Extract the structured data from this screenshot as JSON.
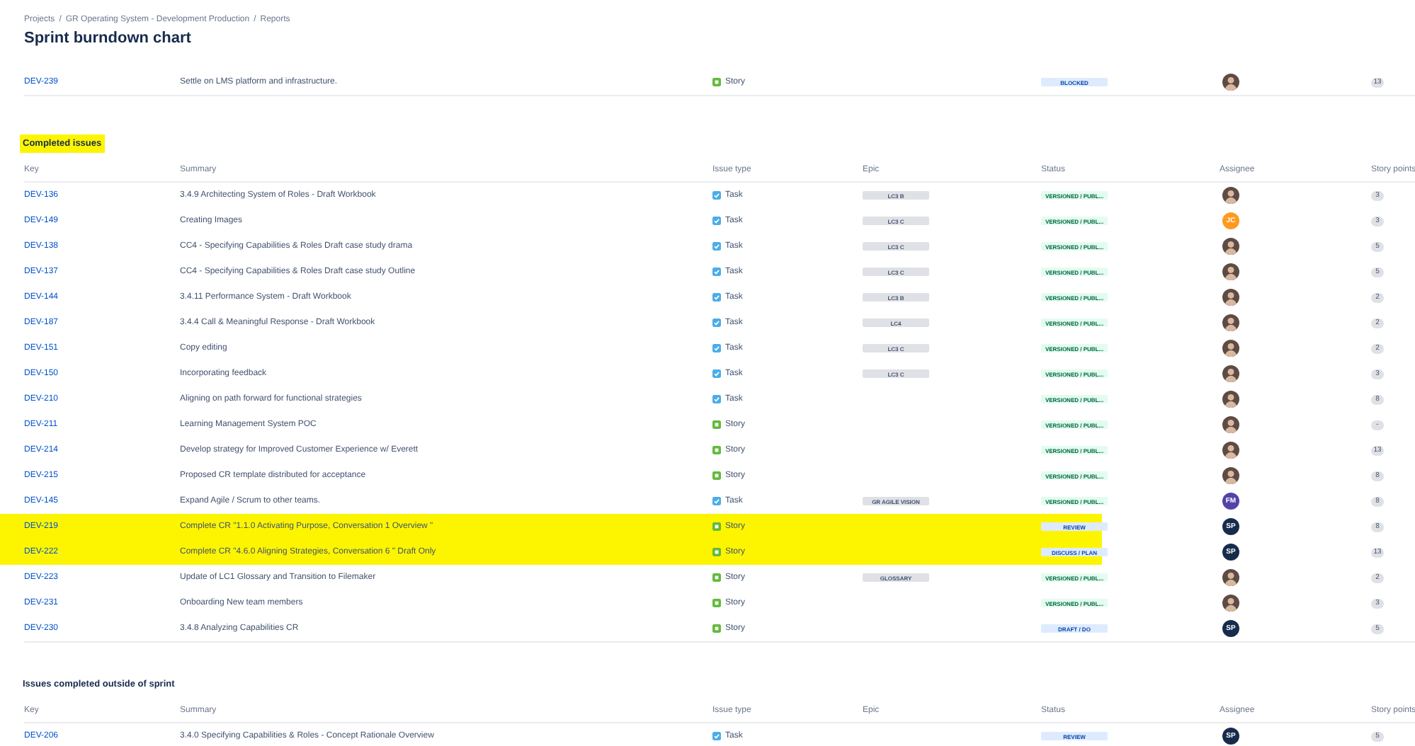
{
  "breadcrumbs": [
    "Projects",
    "GR Operating System - Development Production",
    "Reports"
  ],
  "breadcrumb_separator": "/",
  "title": "Sprint burndown chart",
  "top_rows": [
    {
      "key": "DEV-239",
      "summary": "Settle on LMS platform and infrastructure.",
      "kind": "story",
      "issue_type": "Story",
      "status": {
        "text": "BLOCKED",
        "color": "#0747a6"
      },
      "assignee": {
        "kind": "photo"
      },
      "points": "13",
      "highlighted": false
    }
  ],
  "sections": [
    {
      "title": "Completed issues",
      "highlighted": true,
      "columns": [
        "Key",
        "Summary",
        "Issue type",
        "Epic",
        "Status",
        "Assignee",
        "Story points"
      ],
      "rows": [
        {
          "key": "DEV-136",
          "summary": "3.4.9 Architecting System of Roles - Draft Workbook",
          "kind": "task",
          "issue_type": "Task",
          "epic": "LC3 B",
          "status": {
            "text": "VERSIONED / PUBL...",
            "color": "#006644"
          },
          "assignee": {
            "kind": "photo"
          },
          "points": "3",
          "highlighted": false
        },
        {
          "key": "DEV-149",
          "summary": "Creating Images",
          "kind": "task",
          "issue_type": "Task",
          "epic": "LC3 C",
          "status": {
            "text": "VERSIONED / PUBL...",
            "color": "#006644"
          },
          "assignee": {
            "kind": "initials",
            "initials": "JC",
            "color": "#ff991f"
          },
          "points": "3",
          "highlighted": false
        },
        {
          "key": "DEV-138",
          "summary": "CC4 - Specifying Capabilities & Roles Draft case study drama",
          "kind": "task",
          "issue_type": "Task",
          "epic": "LC3 C",
          "status": {
            "text": "VERSIONED / PUBL...",
            "color": "#006644"
          },
          "assignee": {
            "kind": "photo"
          },
          "points": "5",
          "highlighted": false
        },
        {
          "key": "DEV-137",
          "summary": "CC4 - Specifying Capabilities & Roles Draft case study Outline",
          "kind": "task",
          "issue_type": "Task",
          "epic": "LC3 C",
          "status": {
            "text": "VERSIONED / PUBL...",
            "color": "#006644"
          },
          "assignee": {
            "kind": "photo"
          },
          "points": "5",
          "highlighted": false
        },
        {
          "key": "DEV-144",
          "summary": "3.4.11 Performance System - Draft Workbook",
          "kind": "task",
          "issue_type": "Task",
          "epic": "LC3 B",
          "status": {
            "text": "VERSIONED / PUBL...",
            "color": "#006644"
          },
          "assignee": {
            "kind": "photo"
          },
          "points": "2",
          "highlighted": false
        },
        {
          "key": "DEV-187",
          "summary": "3.4.4 Call & Meaningful Response - Draft Workbook",
          "kind": "task",
          "issue_type": "Task",
          "epic": "LC4",
          "status": {
            "text": "VERSIONED / PUBL...",
            "color": "#006644"
          },
          "assignee": {
            "kind": "photo"
          },
          "points": "2",
          "highlighted": false
        },
        {
          "key": "DEV-151",
          "summary": "Copy editing",
          "kind": "task",
          "issue_type": "Task",
          "epic": "LC3 C",
          "status": {
            "text": "VERSIONED / PUBL...",
            "color": "#006644"
          },
          "assignee": {
            "kind": "photo"
          },
          "points": "2",
          "highlighted": false
        },
        {
          "key": "DEV-150",
          "summary": "Incorporating feedback",
          "kind": "task",
          "issue_type": "Task",
          "epic": "LC3 C",
          "status": {
            "text": "VERSIONED / PUBL...",
            "color": "#006644"
          },
          "assignee": {
            "kind": "photo"
          },
          "points": "3",
          "highlighted": false
        },
        {
          "key": "DEV-210",
          "summary": "Aligning on path forward for functional strategies",
          "kind": "task",
          "issue_type": "Task",
          "status": {
            "text": "VERSIONED / PUBL...",
            "color": "#006644"
          },
          "assignee": {
            "kind": "photo"
          },
          "points": "8",
          "highlighted": false
        },
        {
          "key": "DEV-211",
          "summary": "Learning Management System POC",
          "kind": "story",
          "issue_type": "Story",
          "status": {
            "text": "VERSIONED / PUBL...",
            "color": "#006644"
          },
          "assignee": {
            "kind": "photo"
          },
          "points": "-",
          "highlighted": false
        },
        {
          "key": "DEV-214",
          "summary": "Develop strategy for Improved Customer Experience w/ Everett",
          "kind": "story",
          "issue_type": "Story",
          "status": {
            "text": "VERSIONED / PUBL...",
            "color": "#006644"
          },
          "assignee": {
            "kind": "photo"
          },
          "points": "13",
          "highlighted": false
        },
        {
          "key": "DEV-215",
          "summary": "Proposed CR template distributed for acceptance",
          "kind": "story",
          "issue_type": "Story",
          "status": {
            "text": "VERSIONED / PUBL...",
            "color": "#006644"
          },
          "assignee": {
            "kind": "photo"
          },
          "points": "8",
          "highlighted": false
        },
        {
          "key": "DEV-145",
          "summary": "Expand Agile / Scrum to other teams.",
          "kind": "task",
          "issue_type": "Task",
          "epic": "GR AGILE VISION",
          "status": {
            "text": "VERSIONED / PUBL...",
            "color": "#006644"
          },
          "assignee": {
            "kind": "initials",
            "initials": "FM",
            "color": "#5243aa"
          },
          "points": "8",
          "highlighted": false
        },
        {
          "key": "DEV-219",
          "summary": "Complete CR \"1.1.0 Activating Purpose, Conversation 1 Overview \"",
          "kind": "story",
          "issue_type": "Story",
          "status": {
            "text": "REVIEW",
            "color": "#0747a6"
          },
          "assignee": {
            "kind": "initials",
            "initials": "SP",
            "color": "#172b4d"
          },
          "points": "8",
          "highlighted": true
        },
        {
          "key": "DEV-222",
          "summary": "Complete CR \"4.6.0 Aligning Strategies, Conversation 6 \" Draft Only",
          "kind": "story",
          "issue_type": "Story",
          "status": {
            "text": "DISCUSS / PLAN",
            "color": "#0747a6"
          },
          "assignee": {
            "kind": "initials",
            "initials": "SP",
            "color": "#172b4d"
          },
          "points": "13",
          "highlighted": true
        },
        {
          "key": "DEV-223",
          "summary": "Update of LC1 Glossary and Transition to Filemaker",
          "kind": "story",
          "issue_type": "Story",
          "epic": "GLOSSARY",
          "status": {
            "text": "VERSIONED / PUBL...",
            "color": "#006644"
          },
          "assignee": {
            "kind": "photo"
          },
          "points": "2",
          "highlighted": false
        },
        {
          "key": "DEV-231",
          "summary": "Onboarding New team members",
          "kind": "story",
          "issue_type": "Story",
          "status": {
            "text": "VERSIONED / PUBL...",
            "color": "#006644"
          },
          "assignee": {
            "kind": "photo"
          },
          "points": "3",
          "highlighted": false
        },
        {
          "key": "DEV-230",
          "summary": "3.4.8 Analyzing Capabilities CR",
          "kind": "story",
          "issue_type": "Story",
          "status": {
            "text": "DRAFT / DO",
            "color": "#0747a6"
          },
          "assignee": {
            "kind": "initials",
            "initials": "SP",
            "color": "#172b4d"
          },
          "points": "5",
          "highlighted": false
        }
      ]
    },
    {
      "title": "Issues completed outside of sprint",
      "highlighted": false,
      "columns": [
        "Key",
        "Summary",
        "Issue type",
        "Epic",
        "Status",
        "Assignee",
        "Story points"
      ],
      "rows": [
        {
          "key": "DEV-206",
          "summary": "3.4.0 Specifying Capabilities & Roles - Concept Rationale Overview",
          "kind": "task",
          "issue_type": "Task",
          "status": {
            "text": "REVIEW",
            "color": "#0747a6"
          },
          "assignee": {
            "kind": "initials",
            "initials": "SP",
            "color": "#172b4d"
          },
          "points": "5",
          "highlighted": false
        }
      ]
    }
  ]
}
